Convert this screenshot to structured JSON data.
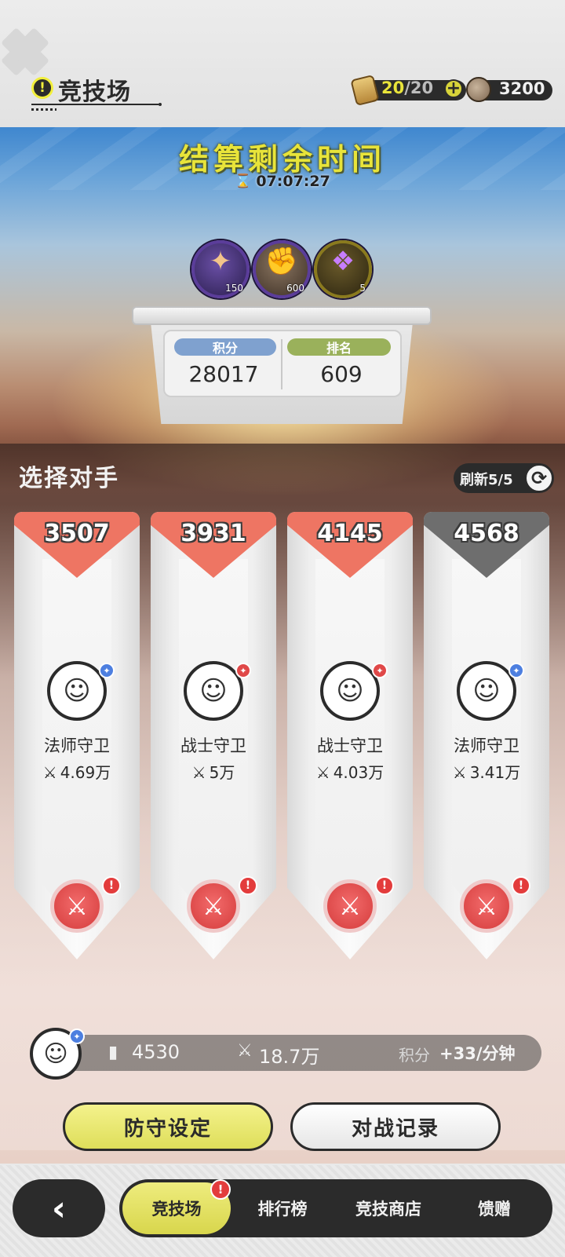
{
  "header": {
    "title": "竞技场",
    "alert_glyph": "!",
    "stamina_current": "20",
    "stamina_sep": "/",
    "stamina_max": "20",
    "plus_glyph": "+",
    "coins": "3200",
    "icons": [
      "alert-icon",
      "ticket-icon",
      "plus-icon",
      "coin-icon"
    ]
  },
  "banner": {
    "countdown_title": "结算剩余时间",
    "countdown_time": "07:07:27",
    "hourglass_glyph": "⌛",
    "rewards": [
      {
        "icon": "star-crystal-icon",
        "glyph": "✦",
        "qty": "150"
      },
      {
        "icon": "fist-medal-icon",
        "glyph": "✊",
        "qty": "600"
      },
      {
        "icon": "potion-bag-icon",
        "glyph": "❖",
        "qty": "5"
      }
    ],
    "score_label": "积分",
    "score_value": "28017",
    "rank_label": "排名",
    "rank_value": "609"
  },
  "opponents": {
    "section_title": "选择对手",
    "refresh_label": "刷新5/5",
    "refresh_glyph": "⟳",
    "cards": [
      {
        "rank": "3507",
        "class": "法师守卫",
        "power": "4.69万",
        "badge": "mage",
        "cap_color": "#ee7563",
        "avatar_glyph": "☺"
      },
      {
        "rank": "3931",
        "class": "战士守卫",
        "power": "5万",
        "badge": "warrior",
        "cap_color": "#ee7563",
        "avatar_glyph": "☺"
      },
      {
        "rank": "4145",
        "class": "战士守卫",
        "power": "4.03万",
        "badge": "warrior",
        "cap_color": "#ee7563",
        "avatar_glyph": "☺"
      },
      {
        "rank": "4568",
        "class": "法师守卫",
        "power": "3.41万",
        "badge": "mage",
        "cap_color": "#6e6e6e",
        "avatar_glyph": "☺"
      }
    ],
    "power_glyph": "⚔",
    "fight_glyph": "⚔",
    "alert_glyph": "!"
  },
  "player": {
    "avatar_glyph": "☺",
    "rank_glyph": "▮",
    "rank": "4530",
    "power_glyph": "⚔",
    "power": "18.7万",
    "rate_label": "积分",
    "rate_value": "+33/分钟"
  },
  "actions": {
    "defense": "防守设定",
    "record": "对战记录"
  },
  "nav": {
    "back_glyph": "‹",
    "tabs": [
      "竞技场",
      "排行榜",
      "竞技商店",
      "馈赠"
    ],
    "alert_glyph": "!"
  },
  "colors": {
    "accent_yellow": "#e8e43a",
    "card_red": "#ee7563",
    "card_gray": "#6e6e6e",
    "score_blue": "#7fa1cf",
    "rank_green": "#9ab15b",
    "dark": "#2b2b2b"
  }
}
